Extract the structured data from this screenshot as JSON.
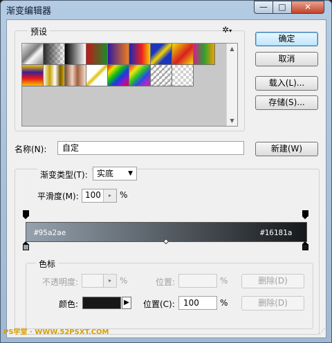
{
  "window": {
    "title": "渐变编辑器",
    "min": "—",
    "max": "□",
    "close": "✕"
  },
  "presets": {
    "legend": "预设",
    "gear_icon": "gear"
  },
  "buttons": {
    "ok": "确定",
    "cancel": "取消",
    "load": "载入(L)...",
    "save": "存储(S)...",
    "new": "新建(W)"
  },
  "name": {
    "label": "名称(N):",
    "value": "自定"
  },
  "type": {
    "label": "渐变类型(T):",
    "value": "实底"
  },
  "smooth": {
    "label": "平滑度(M):",
    "value": "100",
    "unit": "%"
  },
  "gradient": {
    "left_color": "#95a2ae",
    "right_color": "#16181a",
    "left_label": "#95a2ae",
    "right_label": "#16181a"
  },
  "stops": {
    "legend": "色标",
    "opacity_label": "不透明度:",
    "opacity_unit": "%",
    "opacity_location_label": "位置:",
    "opacity_location_unit": "%",
    "opacity_delete": "删除(D)",
    "color_label": "颜色:",
    "color_value": "#16181a",
    "color_location_label": "位置(C):",
    "color_location_value": "100",
    "color_location_unit": "%",
    "color_delete": "删除(D)"
  },
  "watermark": "PS学堂 · WWW.52PSXT.COM"
}
